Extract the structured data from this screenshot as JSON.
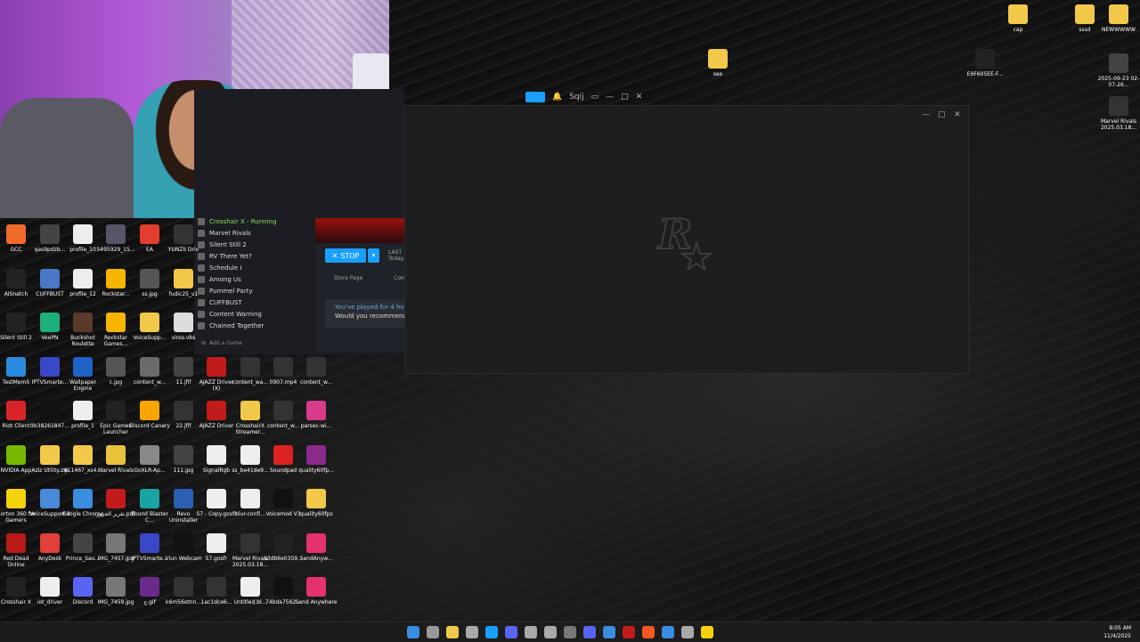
{
  "steam": {
    "games": [
      {
        "label": "Crosshair X - Running",
        "icon": "crosshair-icon",
        "running": true
      },
      {
        "label": "Marvel Rivals",
        "icon": "marvel-rivals-icon"
      },
      {
        "label": "Silent Still 2",
        "icon": "silent-still-icon"
      },
      {
        "label": "RV There Yet?",
        "icon": "rv-icon"
      },
      {
        "label": "Schedule I",
        "icon": "schedule-icon"
      },
      {
        "label": "Among Us",
        "icon": "among-us-icon"
      },
      {
        "label": "Pummel Party",
        "icon": "pummel-party-icon"
      },
      {
        "label": "CUFFBUST",
        "icon": "cuffbust-icon"
      },
      {
        "label": "Content Warning",
        "icon": "content-warning-icon"
      },
      {
        "label": "Chained Together",
        "icon": "chained-together-icon"
      }
    ],
    "add_game": "Add a Game",
    "stop_label": "STOP",
    "last_label": "LAST",
    "last_sub": "Today",
    "store_page": "Store Page",
    "community": "Com",
    "played_text": "You've played for 4 hou",
    "recommend_text": "Would you recommend",
    "user_label": "Sqij"
  },
  "desktop_icons": [
    {
      "label": "GCC",
      "color": "#f06a2a"
    },
    {
      "label": "qas9pdzb...",
      "color": "#444"
    },
    {
      "label": "profile_10",
      "color": "#eee"
    },
    {
      "label": "5495929_15...",
      "color": "#556"
    },
    {
      "label": "EA",
      "color": "#e23d2d"
    },
    {
      "label": "YUNZII Driv",
      "color": "#333"
    },
    {
      "label": "AISnatch",
      "color": "#222"
    },
    {
      "label": "CUFFBUST",
      "color": "#4a78c7"
    },
    {
      "label": "profile_12",
      "color": "#eee"
    },
    {
      "label": "Rockstar...",
      "color": "#f4b400"
    },
    {
      "label": "ss.jpg",
      "color": "#555"
    },
    {
      "label": "fudic25_v1",
      "color": "#f2c84b"
    },
    {
      "label": "Silent Still 2",
      "color": "#222"
    },
    {
      "label": "VeePN",
      "color": "#1db07a"
    },
    {
      "label": "Buckshot Roulette",
      "color": "#5a3a2a"
    },
    {
      "label": "Rockstar Games...",
      "color": "#f4b400"
    },
    {
      "label": "VoiceSupp...",
      "color": "#f2c84b"
    },
    {
      "label": "viros.vbs",
      "color": "#ddd"
    },
    {
      "label": "TestMem5",
      "color": "#2b8be0"
    },
    {
      "label": "IPTVSmarte...",
      "color": "#3a48c8"
    },
    {
      "label": "Wallpaper Engine",
      "color": "#1f63c9"
    },
    {
      "label": "c.jpg",
      "color": "#555"
    },
    {
      "label": "content_w...",
      "color": "#6a6a6a"
    },
    {
      "label": "11.jfif",
      "color": "#444"
    },
    {
      "label": "AJAZZ Driver (X)",
      "color": "#c21b1b"
    },
    {
      "label": "content_wa...",
      "color": "#333"
    },
    {
      "label": "0907.mp4",
      "color": "#333"
    },
    {
      "label": "content_w...",
      "color": "#333"
    },
    {
      "label": "Riot Client",
      "color": "#d8232a"
    },
    {
      "label": "9b38261847...",
      "color": "#111"
    },
    {
      "label": "profile_1",
      "color": "#eee"
    },
    {
      "label": "Epic Games Launcher",
      "color": "#222"
    },
    {
      "label": "Discord Canary",
      "color": "#f7a600"
    },
    {
      "label": "22.jfif",
      "color": "#333"
    },
    {
      "label": "AJAZZ Driver",
      "color": "#c21b1b"
    },
    {
      "label": "CrosshairX Streamer...",
      "color": "#f2c84b"
    },
    {
      "label": "content_w...",
      "color": "#333"
    },
    {
      "label": "parsec-wi...",
      "color": "#d83b8a"
    },
    {
      "label": "NVIDIA App",
      "color": "#76b900"
    },
    {
      "label": "Aziz Utility.zip",
      "color": "#f2c84b"
    },
    {
      "label": "611467_xs4...",
      "color": "#f2c84b"
    },
    {
      "label": "Marvel Rivals",
      "color": "#e8c23a"
    },
    {
      "label": "GoXLR-Ap...",
      "color": "#888"
    },
    {
      "label": "111.jpg",
      "color": "#444"
    },
    {
      "label": "SignalRgb",
      "color": "#eee"
    },
    {
      "label": "ss_be41de9...",
      "color": "#eee"
    },
    {
      "label": "Soundpad",
      "color": "#d22"
    },
    {
      "label": "quality60fp...",
      "color": "#8a2a8a"
    },
    {
      "label": "Norton 360 for Gamers",
      "color": "#f4d20a"
    },
    {
      "label": "VoiceSupport 2",
      "color": "#4a8ad8"
    },
    {
      "label": "Google Chrome",
      "color": "#3a8ddf"
    },
    {
      "label": "تقرير الجرور.pdf",
      "color": "#c21b1b"
    },
    {
      "label": "Sound Blaster C...",
      "color": "#1aa3a3"
    },
    {
      "label": "Revo Uninstaller",
      "color": "#2b5fb3"
    },
    {
      "label": "S7 - Copy.gosfr",
      "color": "#eee"
    },
    {
      "label": "blur-confi...",
      "color": "#eee"
    },
    {
      "label": "Voicemod V3",
      "color": "#111"
    },
    {
      "label": "quality60fps",
      "color": "#f2c84b"
    },
    {
      "label": "Red Dead Online",
      "color": "#b81a1a"
    },
    {
      "label": "AnyDesk",
      "color": "#e2403a"
    },
    {
      "label": "Prince_Sau...",
      "color": "#444"
    },
    {
      "label": "IMG_7457.jpg",
      "color": "#777"
    },
    {
      "label": "IPTVSmarte...",
      "color": "#3a48c8"
    },
    {
      "label": "Iriun Webcam",
      "color": "#111"
    },
    {
      "label": "S7.gosfr",
      "color": "#eee"
    },
    {
      "label": "Marvel Rivals 2025.03.18...",
      "color": "#333"
    },
    {
      "label": "a3db6e0359...",
      "color": "#222"
    },
    {
      "label": "SendAnyw...",
      "color": "#e5316d"
    },
    {
      "label": "Crosshair X",
      "color": "#222"
    },
    {
      "label": "iot_driver",
      "color": "#eee"
    },
    {
      "label": "Discord",
      "color": "#5865f2"
    },
    {
      "label": "IMG_7459.jpg",
      "color": "#777"
    },
    {
      "label": "ح.gif",
      "color": "#6a2a8a"
    },
    {
      "label": "k6m56xtnn...",
      "color": "#333"
    },
    {
      "label": "1ac1dce6...",
      "color": "#333"
    },
    {
      "label": "Untitled.bl...",
      "color": "#eee"
    },
    {
      "label": "74bda7562...",
      "color": "#111"
    },
    {
      "label": "Send Anywhere",
      "color": "#e5316d"
    }
  ],
  "right_icons": [
    {
      "label": "cap",
      "color": "#f2c84b"
    },
    {
      "label": "sssd",
      "color": "#f2c84b"
    },
    {
      "label": "NEWWWWW",
      "color": "#f2c84b"
    },
    {
      "label": "see",
      "color": "#f2c84b"
    },
    {
      "label": "E9F605EE-F...",
      "color": "#222"
    },
    {
      "label": "2025-09-23 02-07-26...",
      "color": "#444"
    },
    {
      "label": "Marvel Rivals 2025.03.18...",
      "color": "#333"
    }
  ],
  "clock": {
    "time": "8:05 AM",
    "date": "11/4/2025"
  },
  "taskbar": {
    "colors": [
      "#3a8ddf",
      "#999",
      "#f2c84b",
      "#aaa",
      "#1a9fff",
      "#5865f2",
      "#aaa",
      "#aaa",
      "#777",
      "#5865f2",
      "#3a8ddf",
      "#c21b1b",
      "#f05a22",
      "#3a8ddf",
      "#aaa",
      "#f4d20a"
    ]
  }
}
